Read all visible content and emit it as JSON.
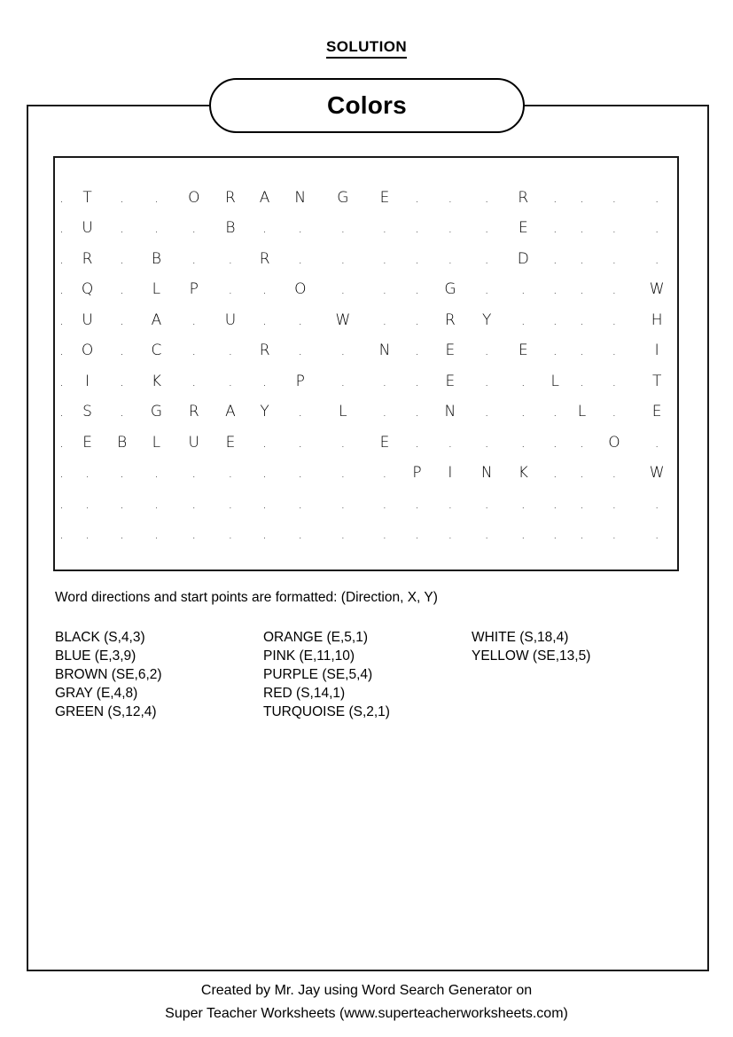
{
  "header": {
    "solution_label": "SOLUTION"
  },
  "title": {
    "text": "Colors"
  },
  "puzzle": {
    "columns": 18,
    "rows": 12,
    "empty_marker": ".",
    "grid": [
      [
        ".",
        "T",
        ".",
        ".",
        "O",
        "R",
        "A",
        "N",
        "G",
        "E",
        ".",
        ".",
        ".",
        "R",
        ".",
        ".",
        ".",
        "."
      ],
      [
        ".",
        "U",
        ".",
        ".",
        ".",
        "B",
        ".",
        ".",
        ".",
        ".",
        ".",
        ".",
        ".",
        "E",
        ".",
        ".",
        ".",
        "."
      ],
      [
        ".",
        "R",
        ".",
        "B",
        ".",
        ".",
        "R",
        ".",
        ".",
        ".",
        ".",
        ".",
        ".",
        "D",
        ".",
        ".",
        ".",
        "."
      ],
      [
        ".",
        "Q",
        ".",
        "L",
        "P",
        ".",
        ".",
        "O",
        ".",
        ".",
        ".",
        "G",
        ".",
        ".",
        ".",
        ".",
        ".",
        "W"
      ],
      [
        ".",
        "U",
        ".",
        "A",
        ".",
        "U",
        ".",
        ".",
        "W",
        ".",
        ".",
        "R",
        "Y",
        ".",
        ".",
        ".",
        ".",
        "H"
      ],
      [
        ".",
        "O",
        ".",
        "C",
        ".",
        ".",
        "R",
        ".",
        ".",
        "N",
        ".",
        "E",
        ".",
        "E",
        ".",
        ".",
        ".",
        "I"
      ],
      [
        ".",
        "I",
        ".",
        "K",
        ".",
        ".",
        ".",
        "P",
        ".",
        ".",
        ".",
        "E",
        ".",
        ".",
        "L",
        ".",
        ".",
        "T"
      ],
      [
        ".",
        "S",
        ".",
        "G",
        "R",
        "A",
        "Y",
        ".",
        "L",
        ".",
        ".",
        "N",
        ".",
        ".",
        ".",
        "L",
        ".",
        "E"
      ],
      [
        ".",
        "E",
        "B",
        "L",
        "U",
        "E",
        ".",
        ".",
        ".",
        "E",
        ".",
        ".",
        ".",
        ".",
        ".",
        ".",
        "O",
        "."
      ],
      [
        ".",
        ".",
        ".",
        ".",
        ".",
        ".",
        ".",
        ".",
        ".",
        ".",
        "P",
        "I",
        "N",
        "K",
        ".",
        ".",
        ".",
        "W"
      ],
      [
        ".",
        ".",
        ".",
        ".",
        ".",
        ".",
        ".",
        ".",
        ".",
        ".",
        ".",
        ".",
        ".",
        ".",
        ".",
        ".",
        ".",
        "."
      ],
      [
        ".",
        ".",
        ".",
        ".",
        ".",
        ".",
        ".",
        ".",
        ".",
        ".",
        ".",
        ".",
        ".",
        ".",
        ".",
        ".",
        ".",
        "."
      ]
    ]
  },
  "legend": {
    "note": "Word directions and start points are formatted: (Direction, X, Y)"
  },
  "word_list": {
    "columns": [
      [
        "BLACK (S,4,3)",
        "BLUE (E,3,9)",
        "BROWN (SE,6,2)",
        "GRAY (E,4,8)",
        "GREEN (S,12,4)"
      ],
      [
        "ORANGE (E,5,1)",
        "PINK (E,11,10)",
        "PURPLE (SE,5,4)",
        "RED (S,14,1)",
        "TURQUOISE (S,2,1)"
      ],
      [
        "WHITE (S,18,4)",
        "YELLOW (SE,13,5)"
      ]
    ]
  },
  "footer": {
    "line1": "Created by Mr. Jay using Word Search Generator on",
    "line2": "Super Teacher Worksheets (www.superteacherworksheets.com)"
  }
}
